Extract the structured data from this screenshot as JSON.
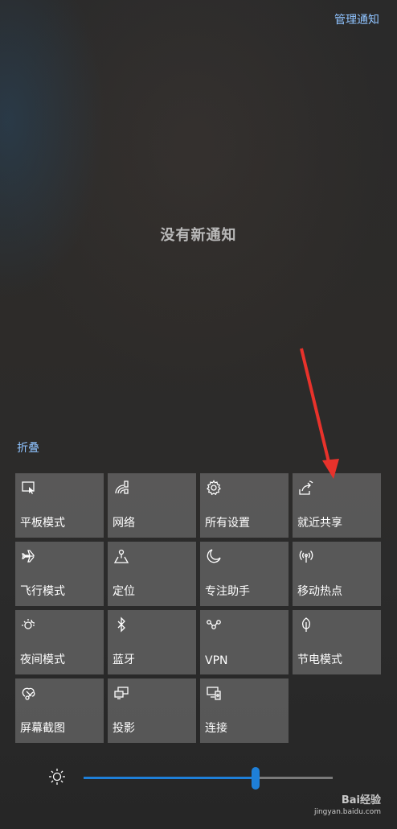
{
  "header": {
    "manage_label": "管理通知"
  },
  "center": {
    "empty_text": "没有新通知"
  },
  "collapse_label": "折叠",
  "tiles": [
    {
      "label": "平板模式",
      "icon": "tablet-mode-icon"
    },
    {
      "label": "网络",
      "icon": "network-icon"
    },
    {
      "label": "所有设置",
      "icon": "gear-icon"
    },
    {
      "label": "就近共享",
      "icon": "nearby-share-icon"
    },
    {
      "label": "飞行模式",
      "icon": "airplane-icon"
    },
    {
      "label": "定位",
      "icon": "location-icon"
    },
    {
      "label": "专注助手",
      "icon": "moon-icon"
    },
    {
      "label": "移动热点",
      "icon": "hotspot-icon"
    },
    {
      "label": "夜间模式",
      "icon": "night-light-icon"
    },
    {
      "label": "蓝牙",
      "icon": "bluetooth-icon"
    },
    {
      "label": "VPN",
      "icon": "vpn-icon"
    },
    {
      "label": "节电模式",
      "icon": "battery-saver-icon"
    },
    {
      "label": "屏幕截图",
      "icon": "screen-snip-icon"
    },
    {
      "label": "投影",
      "icon": "project-icon"
    },
    {
      "label": "连接",
      "icon": "connect-icon"
    }
  ],
  "brightness": {
    "icon": "brightness-sun-icon",
    "level": 0.69,
    "accent": "#1e7fd8"
  },
  "watermark": {
    "brand": "Bai经验",
    "url": "jingyan.baidu.com"
  },
  "annotation": {
    "arrow_color": "#e8322b"
  }
}
